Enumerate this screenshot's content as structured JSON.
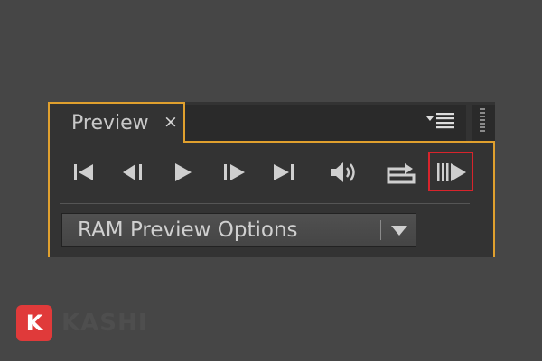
{
  "panel": {
    "tab_label": "Preview",
    "close_glyph": "×",
    "menu_icon": "panel-menu-icon",
    "accent_color": "#e0a02e"
  },
  "controls": [
    {
      "name": "first-frame-button",
      "icon": "first-frame-icon"
    },
    {
      "name": "previous-frame-button",
      "icon": "previous-frame-icon"
    },
    {
      "name": "play-pause-button",
      "icon": "play-icon"
    },
    {
      "name": "next-frame-button",
      "icon": "next-frame-icon"
    },
    {
      "name": "last-frame-button",
      "icon": "last-frame-icon"
    },
    {
      "name": "mute-audio-button",
      "icon": "speaker-icon"
    },
    {
      "name": "loop-button",
      "icon": "loop-icon"
    },
    {
      "name": "ram-preview-button",
      "icon": "ram-preview-icon",
      "highlighted": true,
      "highlight_color": "#d8242c"
    }
  ],
  "ram_preview": {
    "selected": "RAM Preview Options"
  },
  "watermark": {
    "badge": "K",
    "text": "KASHI",
    "badge_color": "#e03a3a"
  }
}
